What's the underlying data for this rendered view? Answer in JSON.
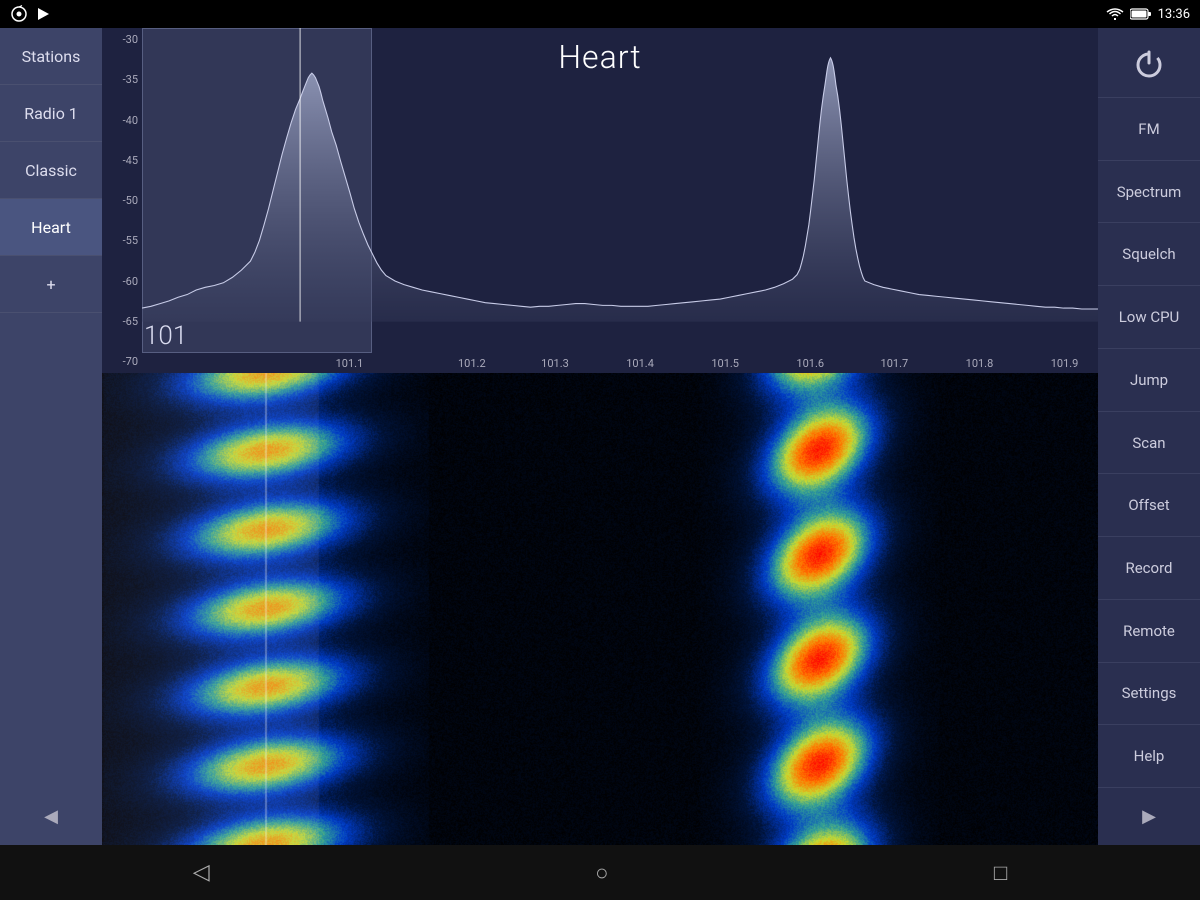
{
  "status_bar": {
    "time": "13:36",
    "signal": "▼"
  },
  "left_sidebar": {
    "items": [
      {
        "id": "stations",
        "label": "Stations",
        "active": false
      },
      {
        "id": "radio1",
        "label": "Radio 1",
        "active": false
      },
      {
        "id": "classic",
        "label": "Classic",
        "active": false
      },
      {
        "id": "heart",
        "label": "Heart",
        "active": true
      }
    ],
    "add_label": "+",
    "back_arrow": "◀"
  },
  "spectrum": {
    "title": "Heart",
    "frequency": "101",
    "y_labels": [
      "-30",
      "-35",
      "-40",
      "-45",
      "-50",
      "-55",
      "-60",
      "-65",
      "-70"
    ],
    "freq_labels": [
      "101.1",
      "101.2",
      "101.3",
      "101.4",
      "101.5",
      "101.6",
      "101.7",
      "101.8",
      "101.9"
    ]
  },
  "right_sidebar": {
    "power_icon": "⏻",
    "buttons": [
      {
        "id": "fm",
        "label": "FM"
      },
      {
        "id": "spectrum",
        "label": "Spectrum"
      },
      {
        "id": "squelch",
        "label": "Squelch"
      },
      {
        "id": "low-cpu",
        "label": "Low CPU"
      },
      {
        "id": "jump",
        "label": "Jump"
      },
      {
        "id": "scan",
        "label": "Scan"
      },
      {
        "id": "offset",
        "label": "Offset"
      },
      {
        "id": "record",
        "label": "Record"
      },
      {
        "id": "remote",
        "label": "Remote"
      },
      {
        "id": "settings",
        "label": "Settings"
      },
      {
        "id": "help",
        "label": "Help"
      }
    ],
    "forward_arrow": "▶"
  },
  "nav_bar": {
    "back": "◁",
    "home": "○",
    "recent": "□"
  }
}
